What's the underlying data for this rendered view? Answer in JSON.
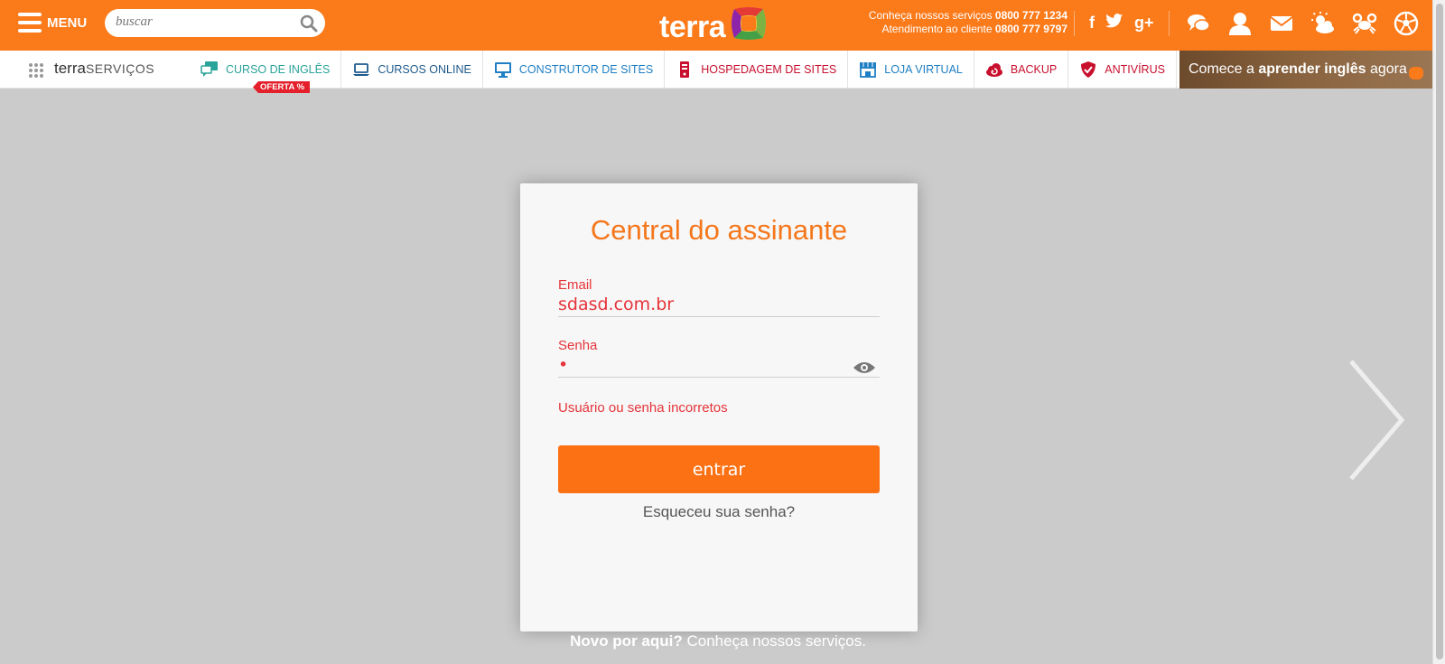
{
  "header": {
    "menu_label": "MENU",
    "search_placeholder": "buscar",
    "logo_text": "terra",
    "contact_line1_prefix": "Conheça nossos serviços",
    "contact_line1_number": "0800 777 1234",
    "contact_line2_prefix": "Atendimento ao cliente",
    "contact_line2_number": "0800 777 9797",
    "social": [
      "f",
      "t",
      "g+"
    ],
    "accent_color": "#fb7a1a"
  },
  "services_bar": {
    "brand_main": "terra",
    "brand_sub": "SERVIÇOS",
    "items": [
      {
        "label": "CURSO DE INGLÊS",
        "badge": "OFERTA %"
      },
      {
        "label": "CURSOS ONLINE"
      },
      {
        "label": "CONSTRUTOR DE SITES"
      },
      {
        "label": "HOSPEDAGEM DE SITES"
      },
      {
        "label": "LOJA VIRTUAL"
      },
      {
        "label": "BACKUP"
      },
      {
        "label": "ANTIVÍRUS"
      }
    ],
    "banner_prefix": "Comece a",
    "banner_bold": "aprender inglês",
    "banner_suffix": "agora"
  },
  "login": {
    "title": "Central do assinante",
    "email_label": "Email",
    "email_value": "sdasd.com.br",
    "password_label": "Senha",
    "password_value": "•",
    "error": "Usuário ou senha incorretos",
    "submit_label": "entrar",
    "forgot_label": "Esqueceu sua senha?"
  },
  "footer": {
    "bold": "Novo por aqui?",
    "text": "Conheça nossos serviços."
  }
}
